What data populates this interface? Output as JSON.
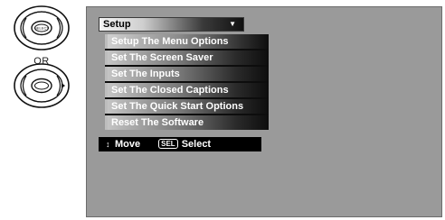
{
  "remote": {
    "top_button_label": "SELECT",
    "or_label": "OR"
  },
  "menu": {
    "title": "Setup",
    "caret": "▼",
    "items": [
      {
        "label": "Setup The Menu Options",
        "selected": true
      },
      {
        "label": "Set The Screen Saver",
        "selected": false
      },
      {
        "label": "Set The Inputs",
        "selected": false
      },
      {
        "label": "Set The Closed Captions",
        "selected": false
      },
      {
        "label": "Set The Quick Start Options",
        "selected": false
      },
      {
        "label": "Reset The Software",
        "selected": false
      }
    ]
  },
  "status": {
    "move_label": "Move",
    "sel_key": "SEL",
    "select_label": "Select"
  }
}
